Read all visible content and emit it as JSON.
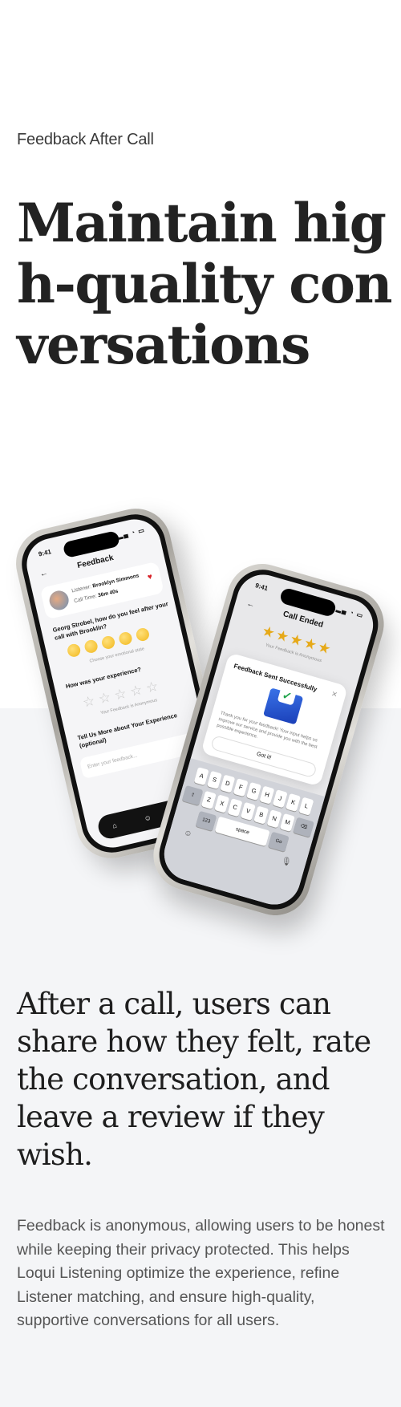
{
  "eyebrow": "Feedback After Call",
  "headline": "Maintain high-quality conversations",
  "subheadline": "After a call, users can share how they felt, rate the conversation, and leave a review if they wish.",
  "body": "Feedback is anonymous, allowing users to be honest while keeping their privacy protected.  This helps Loqui Listening optimize the experience, refine Listener matching, and ensure high-quality, supportive conversations for all users.",
  "colors": {
    "accent": "#2b4fd8",
    "star": "#f3b31a",
    "heart": "#d8232a",
    "section_bg": "#f4f5f7"
  },
  "phone1": {
    "time": "9:41",
    "title": "Feedback",
    "listener_label": "Listener:",
    "listener_name": "Brooklyn Simmons",
    "call_time_label": "Call Time:",
    "call_time_value": "36m 40s",
    "question_feel": "Georg Strobel, how do you feel after your call with Brooklin?",
    "choose_hint": "Choose your emotional state",
    "question_experience": "How was your experience?",
    "anon_note": "Your Feedback is Anonymous",
    "question_more": "Tell Us More about Your Experience (optional)",
    "input_placeholder": "Enter your feedback...",
    "icons": [
      "home-icon",
      "people-icon",
      "phone-icon"
    ]
  },
  "phone2": {
    "time": "9:41",
    "title": "Call Ended",
    "anon_note": "Your Feedback is Anonymous",
    "rating": 5,
    "modal_title": "Feedback Sent Successfully",
    "modal_body": "Thank you for your feedback! Your input helps us improve our service and provide you with the best possible experience.",
    "modal_button": "Got it!",
    "keyboard_rows": [
      [
        "A",
        "S",
        "D",
        "F",
        "G",
        "H",
        "J",
        "K",
        "L"
      ],
      [
        "Z",
        "X",
        "C",
        "V",
        "B",
        "N",
        "M"
      ]
    ],
    "key_123": "123",
    "key_space": "space",
    "key_go": "Go"
  }
}
